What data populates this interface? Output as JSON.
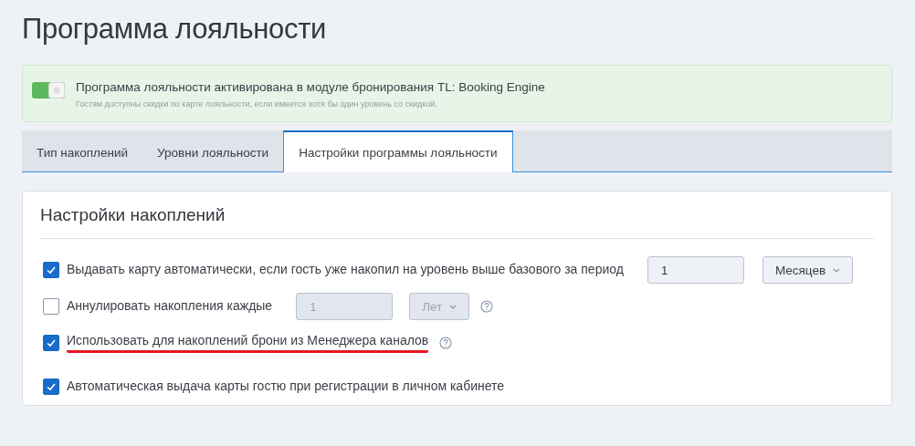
{
  "page_title": "Программа лояльности",
  "banner": {
    "switch_on": true,
    "title": "Программа лояльности активирована в модуле бронирования TL: Booking Engine",
    "note": "Гостям доступны скидки по карте лояльности, если имеется хотя бы один уровень со скидкой."
  },
  "tabs": [
    {
      "label": "Тип накоплений",
      "selected": false
    },
    {
      "label": "Уровни лояльности",
      "selected": false
    },
    {
      "label": "Настройки программы лояльности",
      "selected": true
    }
  ],
  "section": {
    "title": "Настройки накоплений",
    "options": [
      {
        "label": "Выдавать карту автоматически, если гость уже накопил на уровень выше базового за период",
        "checked": true,
        "disabled": false,
        "underlined": false,
        "field_value": "1",
        "dropdown_value": "Месяцев"
      },
      {
        "label": "Аннулировать накопления каждые",
        "checked": false,
        "disabled": true,
        "underlined": false,
        "help": true,
        "field_value": "1",
        "dropdown_value": "Лет"
      },
      {
        "label": "Использовать для накоплений брони из Менеджера каналов",
        "checked": true,
        "underlined": true,
        "help": true
      },
      {
        "label": "Автоматическая выдача карты гостю при регистрации в личном кабинете",
        "checked": true,
        "underlined": false
      }
    ]
  }
}
